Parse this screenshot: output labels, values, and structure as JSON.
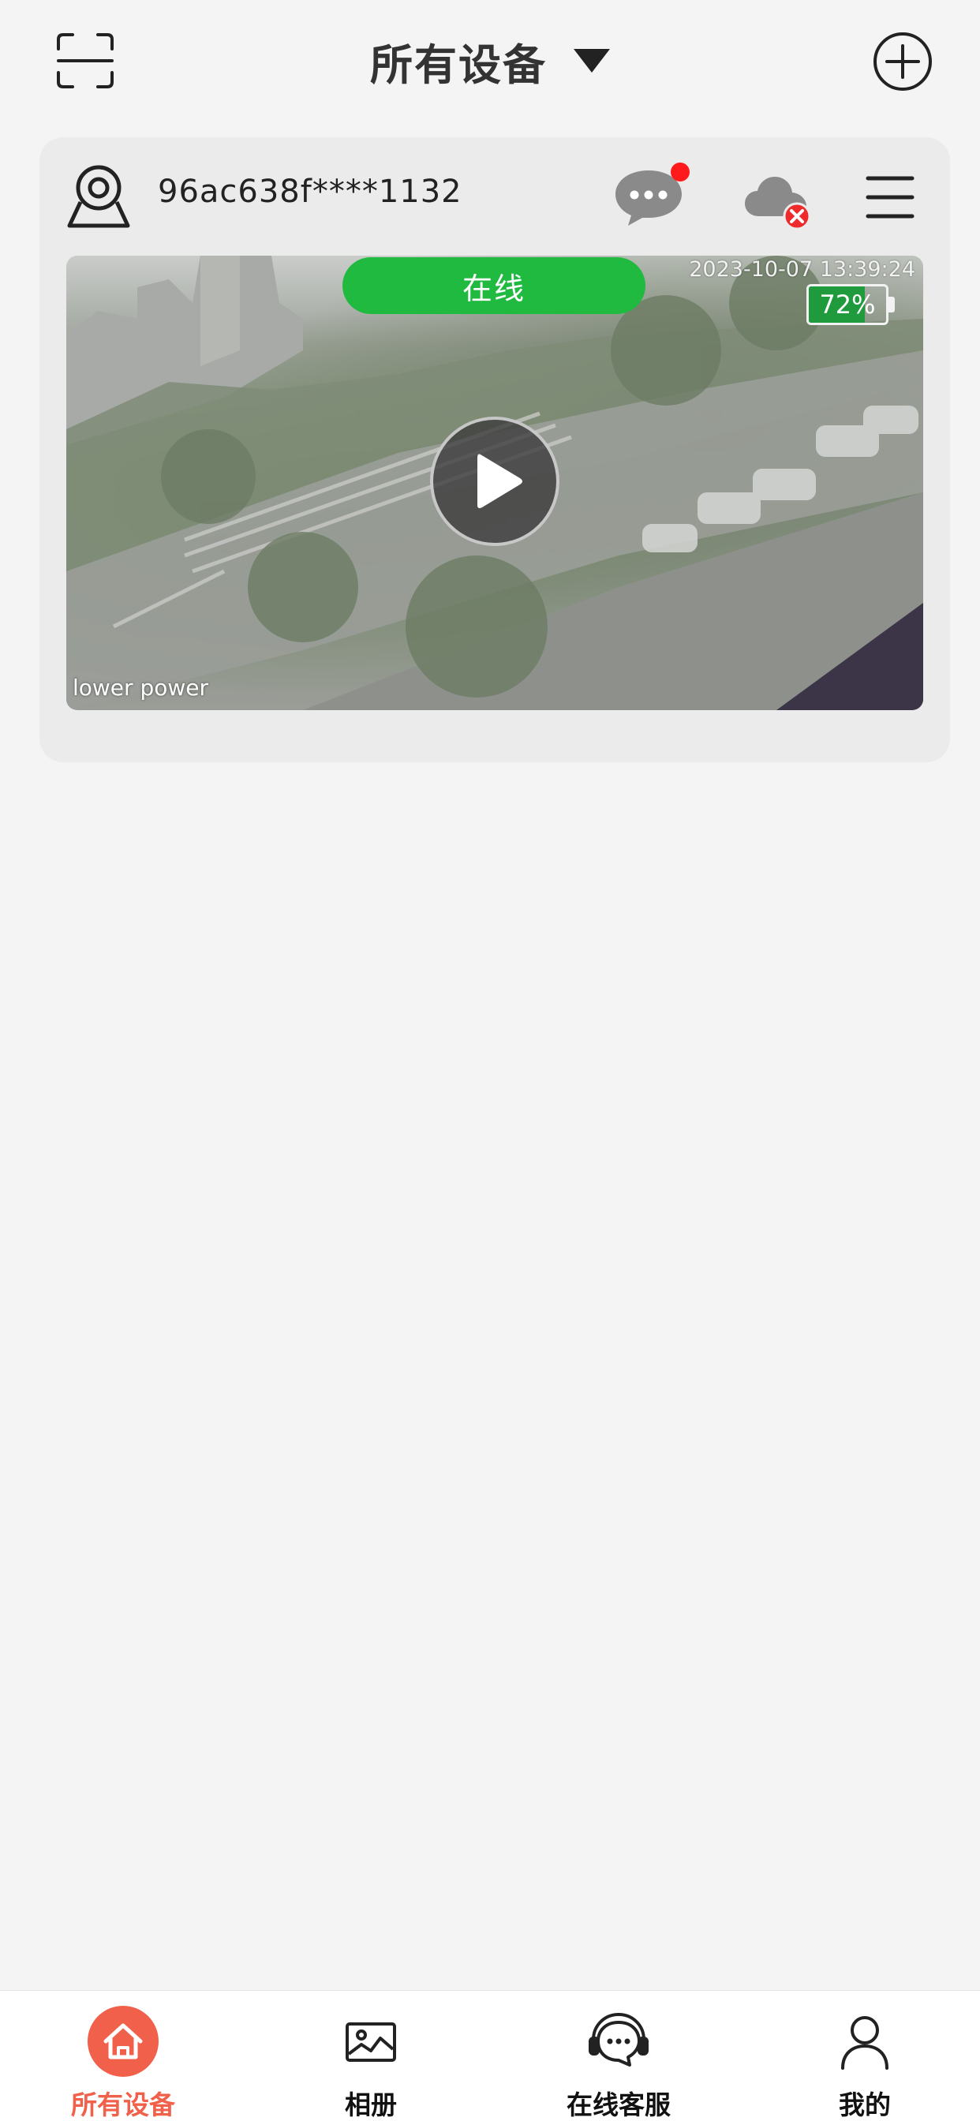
{
  "header": {
    "title": "所有设备"
  },
  "device": {
    "id": "96ac638f****1132",
    "status": "在线",
    "timestamp": "2023-10-07 13:39:24",
    "battery_label": "72%",
    "battery_level": 0.72,
    "overlay_text": "lower power",
    "has_unread_message": true,
    "cloud_status": "disconnected"
  },
  "colors": {
    "accent": "#f0604a",
    "online_green": "#1fba3f",
    "badge_red": "#ff1b1b"
  },
  "tabs": [
    {
      "label": "所有设备",
      "icon": "home-icon",
      "active": true
    },
    {
      "label": "相册",
      "icon": "album-icon",
      "active": false
    },
    {
      "label": "在线客服",
      "icon": "support-icon",
      "active": false
    },
    {
      "label": "我的",
      "icon": "profile-icon",
      "active": false
    }
  ]
}
